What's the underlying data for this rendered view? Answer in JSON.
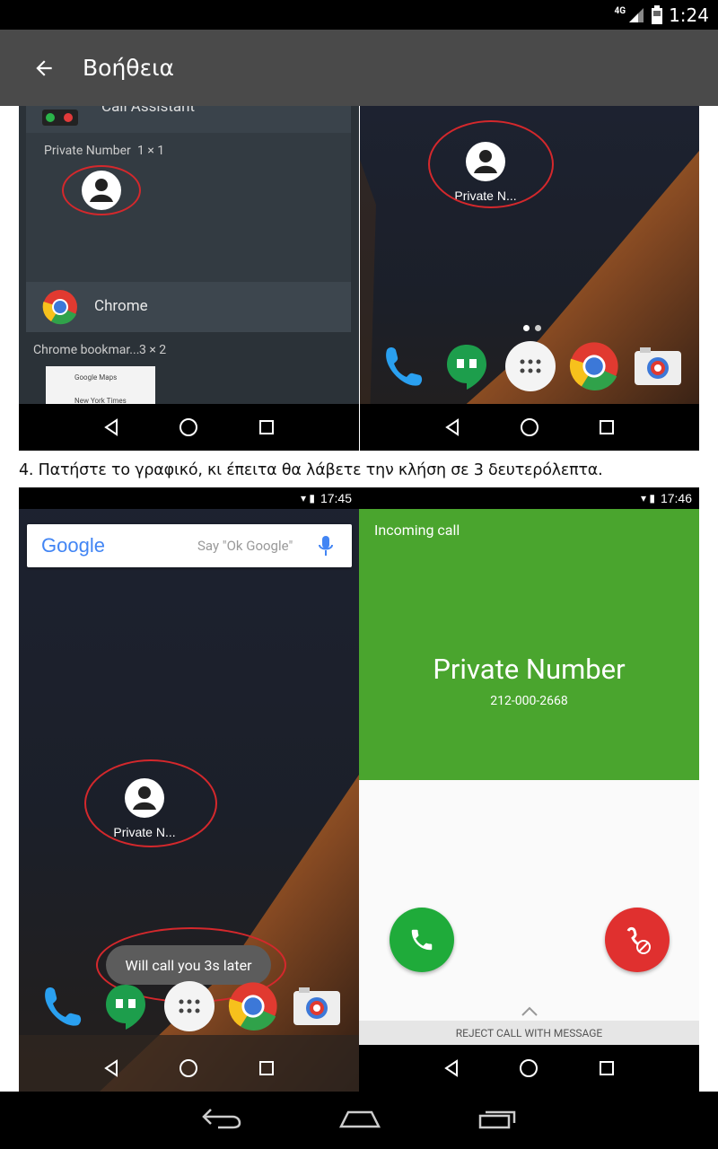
{
  "status_bar": {
    "network": "4G",
    "time": "1:24"
  },
  "app_bar": {
    "title": "Βοήθεια"
  },
  "screenshot1_left": {
    "header_partial": "Call Assistant",
    "widget_name": "Private Number",
    "widget_size": "1 × 1",
    "chrome_label": "Chrome",
    "chrome_bookmarks_name": "Chrome bookmar...",
    "chrome_bookmarks_size": "3 × 2",
    "bookmark_item_1": "Google Maps",
    "bookmark_item_2": "New York Times"
  },
  "screenshot1_right": {
    "widget_label": "Private N..."
  },
  "caption": "4. Πατήστε το γραφικό, κι έπειτα θα λάβετε την κλήση σε 3 δευτερόλεπτα.",
  "screenshot2_left": {
    "time": "17:45",
    "google_logo": "Google",
    "search_hint": "Say \"Ok Google\"",
    "widget_label": "Private N...",
    "toast": "Will call you 3s later"
  },
  "screenshot2_right": {
    "time": "17:46",
    "incoming_label": "Incoming call",
    "caller_name": "Private Number",
    "caller_number": "212-000-2668",
    "reject_message": "REJECT CALL WITH MESSAGE"
  },
  "colors": {
    "accent_green": "#4aa52e",
    "answer_green": "#1fab3a",
    "decline_red": "#e0302f",
    "ellipse_red": "#d4282c"
  }
}
